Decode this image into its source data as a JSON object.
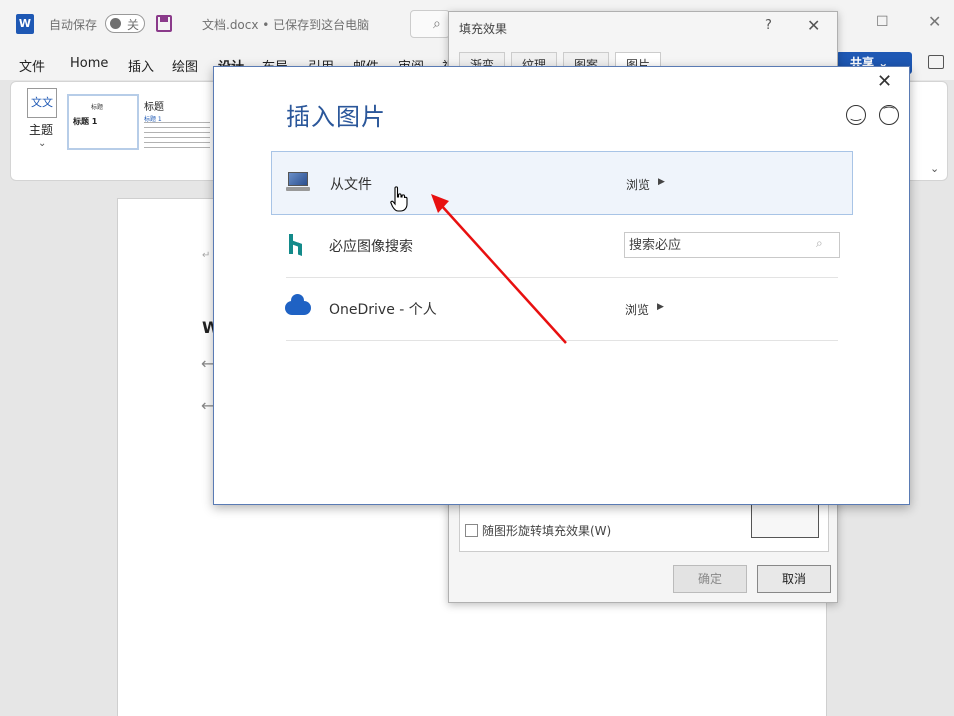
{
  "word": {
    "app_logo": "W",
    "autosave_label": "自动保存",
    "autosave_state": "关",
    "doc_title": "文档.docx • 已保存到这台电脑",
    "share_label": "共享",
    "menu": [
      "文件",
      "Home",
      "插入",
      "绘图",
      "设计",
      "布局",
      "引用",
      "邮件",
      "审阅",
      "视"
    ],
    "ribbon": {
      "theme_label": "主题",
      "theme_icon_text": "文文",
      "style_thumb_title": "标题",
      "style_thumb_h1": "标题 1",
      "style2_title": "标题",
      "style2_h1": "标题 1"
    },
    "doc": {
      "letter": "W"
    }
  },
  "fill_dialog": {
    "title": "填充效果",
    "help": "?",
    "tabs": [
      "渐变",
      "纹理",
      "图案",
      "图片"
    ],
    "rotate_label": "随图形旋转填充效果(W)",
    "ok": "确定",
    "cancel": "取消"
  },
  "insert_dialog": {
    "title": "插入图片",
    "rows": [
      {
        "label": "从文件",
        "action": "浏览",
        "icon": "computer-icon",
        "selected": true
      },
      {
        "label": "必应图像搜索",
        "search_placeholder": "搜索必应",
        "icon": "bing-icon"
      },
      {
        "label": "OneDrive - 个人",
        "action": "浏览",
        "icon": "onedrive-icon"
      }
    ]
  },
  "colors": {
    "accent": "#2b579a",
    "word_blue": "#1e58b4",
    "selection_bg": "#eff4fb",
    "annotation_arrow": "#e81010"
  }
}
